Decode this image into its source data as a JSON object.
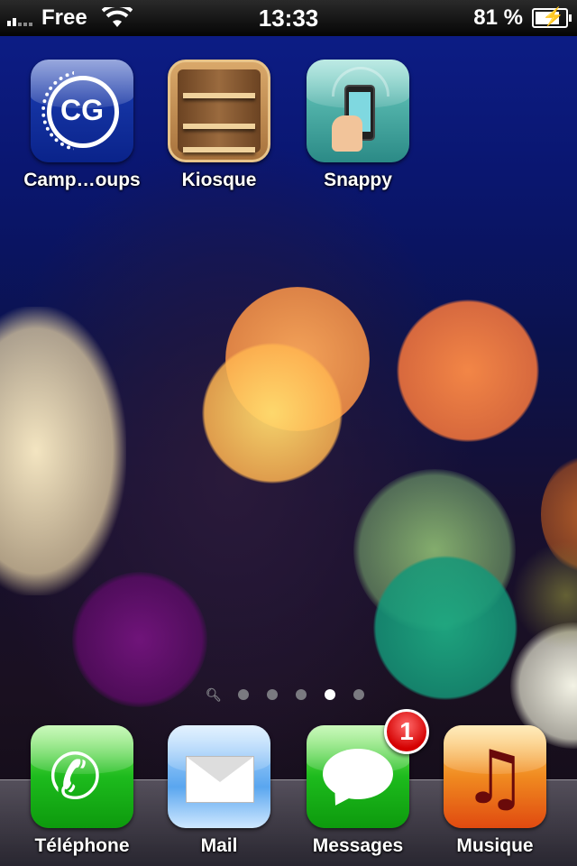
{
  "status_bar": {
    "carrier": "Free",
    "time": "13:33",
    "battery_percent": "81 %",
    "signal_bars": 2,
    "battery_level": 0.81,
    "charging": true
  },
  "home_apps": [
    {
      "label": "Camp…oups",
      "icon": "campgroups-icon"
    },
    {
      "label": "Kiosque",
      "icon": "newsstand-icon"
    },
    {
      "label": "Snappy",
      "icon": "snappy-icon"
    }
  ],
  "page_indicator": {
    "pages": 5,
    "current_page": 4,
    "has_spotlight": true
  },
  "dock": [
    {
      "label": "Téléphone",
      "icon": "phone-icon"
    },
    {
      "label": "Mail",
      "icon": "mail-icon"
    },
    {
      "label": "Messages",
      "icon": "messages-icon",
      "badge": "1"
    },
    {
      "label": "Musique",
      "icon": "music-icon"
    }
  ],
  "icon_text": {
    "campgroups": "CG"
  },
  "colors": {
    "badge": "#d40000",
    "wallpaper_top": "#0d1e8a"
  }
}
